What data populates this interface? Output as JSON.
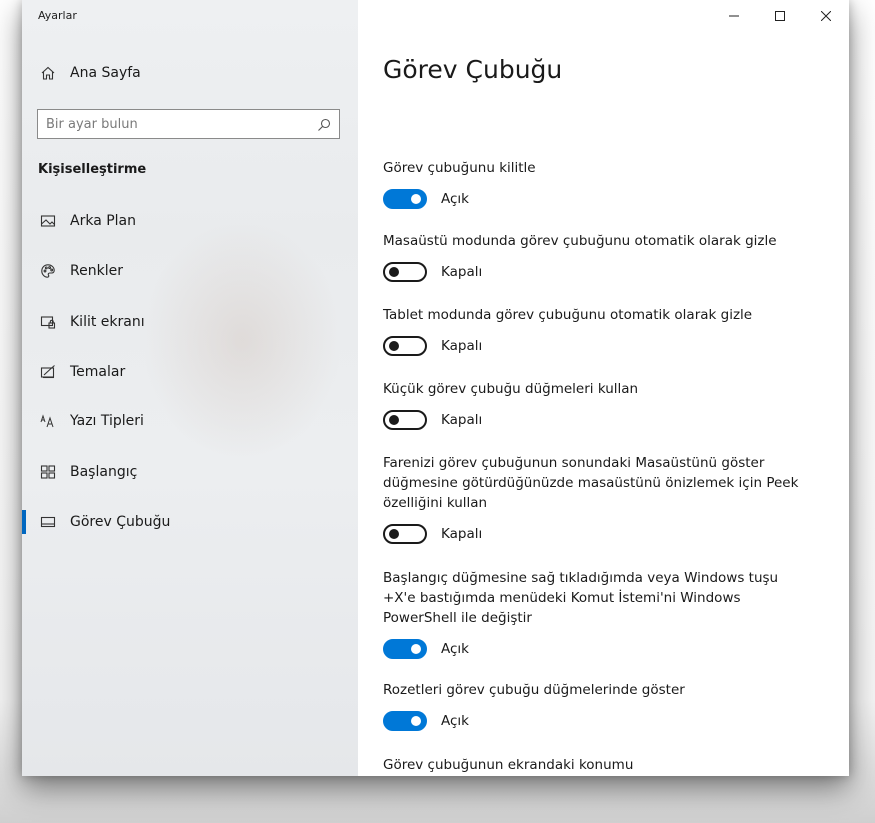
{
  "window": {
    "app_title": "Ayarlar"
  },
  "sidebar": {
    "home_label": "Ana Sayfa",
    "search_placeholder": "Bir ayar bulun",
    "section_title": "Kişiselleştirme",
    "items": [
      {
        "label": "Arka Plan",
        "icon": "picture-icon"
      },
      {
        "label": "Renkler",
        "icon": "palette-icon"
      },
      {
        "label": "Kilit ekranı",
        "icon": "lock-screen-icon"
      },
      {
        "label": "Temalar",
        "icon": "themes-icon"
      },
      {
        "label": "Yazı Tipleri",
        "icon": "fonts-icon"
      },
      {
        "label": "Başlangıç",
        "icon": "start-icon"
      },
      {
        "label": "Görev Çubuğu",
        "icon": "taskbar-icon",
        "active": true
      }
    ]
  },
  "main": {
    "title": "Görev Çubuğu",
    "settings": [
      {
        "label": "Görev çubuğunu kilitle",
        "state": "Açık",
        "on": true
      },
      {
        "label": "Masaüstü modunda görev çubuğunu otomatik olarak gizle",
        "state": "Kapalı",
        "on": false
      },
      {
        "label": "Tablet modunda görev çubuğunu otomatik olarak gizle",
        "state": "Kapalı",
        "on": false
      },
      {
        "label": "Küçük görev çubuğu düğmeleri kullan",
        "state": "Kapalı",
        "on": false
      },
      {
        "label_lines": [
          "Farenizi görev çubuğunun sonundaki Masaüstünü göster",
          "düğmesine götürdüğünüzde masaüstünü önizlemek için Peek",
          "özelliğini kullan"
        ],
        "state": "Kapalı",
        "on": false
      },
      {
        "label_lines": [
          "Başlangıç düğmesine sağ tıkladığımda veya Windows tuşu",
          "+X'e bastığımda menüdeki Komut İstemi'ni Windows",
          "PowerShell ile değiştir"
        ],
        "state": "Açık",
        "on": true
      },
      {
        "label": "Rozetleri görev çubuğu düğmelerinde göster",
        "state": "Açık",
        "on": true
      }
    ],
    "last_heading": "Görev çubuğunun ekrandaki konumu"
  },
  "colors": {
    "accent": "#0078d7",
    "active_indicator": "#0067c0"
  }
}
